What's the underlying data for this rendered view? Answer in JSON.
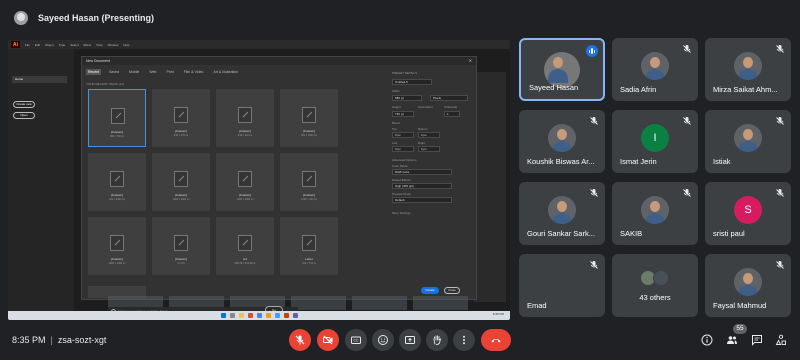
{
  "presenter_bar": {
    "name": "Sayeed Hasan (Presenting)"
  },
  "shared_screen": {
    "app_logo": "Ai",
    "menu": [
      "File",
      "Edit",
      "Object",
      "Type",
      "Select",
      "Effect",
      "View",
      "Window",
      "Help"
    ],
    "home_pane": {
      "home_label": "Home",
      "create_new": "Create new",
      "open": "Open"
    },
    "dialog": {
      "title": "New Document",
      "tabs": [
        "Recent",
        "Saved",
        "Mobile",
        "Web",
        "Print",
        "Film & Video",
        "Art & Illustration"
      ],
      "recent_label": "YOUR RECENT ITEMS (14)",
      "docs": [
        {
          "name": "[Custom]",
          "size": "980 x 720 px"
        },
        {
          "name": "[Custom]",
          "size": "440 x 178 px"
        },
        {
          "name": "[Custom]",
          "size": "440 x 110 px"
        },
        {
          "name": "[Custom]",
          "size": "800 x 1600 px"
        },
        {
          "name": "[Custom]",
          "size": "442 x 1400 px"
        },
        {
          "name": "[Custom]",
          "size": "1024 x 1024 px"
        },
        {
          "name": "[Custom]",
          "size": "1000 x 1000 px"
        },
        {
          "name": "[Custom]",
          "size": "1200 x 400 px"
        },
        {
          "name": "[Custom]",
          "size": "1920 x 1080 px"
        },
        {
          "name": "[Custom]",
          "size": "4 x 3 ft"
        },
        {
          "name": "A4",
          "size": "595.28 x 841.89 pt"
        },
        {
          "name": "Letter",
          "size": "612 x 792 pt"
        }
      ],
      "template_search_placeholder": "Find more templates on Adobe Stock",
      "go_label": "Go",
      "preset": {
        "header": "PRESET DETAILS",
        "doc_name": "Untitled-5",
        "width_label": "Width",
        "width_value": "980 px",
        "units": "Pixels",
        "height_label": "Height",
        "height_value": "720 px",
        "orientation_label": "Orientation",
        "artboards_label": "Artboards",
        "artboards_value": "1",
        "bleed_label": "Bleed",
        "top_label": "Top",
        "bottom_label": "Bottom",
        "left_label": "Left",
        "right_label": "Right",
        "bleed_value": "0 px",
        "advanced_label": "Advanced Options",
        "color_mode_label": "Color Mode",
        "color_mode_value": "RGB Color",
        "raster_label": "Raster Effects",
        "raster_value": "High (300 ppi)",
        "preview_label": "Preview Mode",
        "preview_value": "Default",
        "more_settings": "More Settings"
      },
      "create_label": "Create",
      "close_label": "Close"
    },
    "taskbar_time": "8:35 PM"
  },
  "participants": [
    {
      "name": "Sayeed Hasan",
      "avatar": "photo",
      "state": "speaking"
    },
    {
      "name": "Sadia Afrin",
      "avatar": "photo",
      "state": "muted"
    },
    {
      "name": "Mirza Saikat Ahm...",
      "avatar": "photo",
      "state": "muted"
    },
    {
      "name": "Koushik Biswas Ar...",
      "avatar": "photo",
      "state": "muted"
    },
    {
      "name": "Ismat Jerin",
      "avatar": "I",
      "state": "muted"
    },
    {
      "name": "Istiak",
      "avatar": "photo",
      "state": "muted"
    },
    {
      "name": "Gouri Sankar Sark...",
      "avatar": "photo",
      "state": "muted"
    },
    {
      "name": "SAKIB",
      "avatar": "photo",
      "state": "muted"
    },
    {
      "name": "sristi paul",
      "avatar": "S",
      "state": "muted"
    },
    {
      "name": "Emad",
      "avatar": "none",
      "state": "muted"
    },
    {
      "name": "43 others",
      "avatar": "group",
      "state": "none"
    },
    {
      "name": "Faysal Mahmud",
      "avatar": "photo",
      "state": "muted"
    }
  ],
  "colors": {
    "background": "#202124",
    "tile": "#3c4043",
    "active_border": "#8ab4f8",
    "danger": "#ea4335",
    "accent": "#1a73e8",
    "ismat_initial": "#0b8043",
    "sristi_initial": "#d81b60"
  },
  "bottom_bar": {
    "time": "8:35 PM",
    "separator": "|",
    "meeting_code": "zsa-sozt-xgt",
    "controls": [
      {
        "name": "mic-off-icon",
        "state": "off"
      },
      {
        "name": "camera-off-icon",
        "state": "off"
      },
      {
        "name": "captions-icon",
        "state": "normal"
      },
      {
        "name": "emoji-icon",
        "state": "normal"
      },
      {
        "name": "present-icon",
        "state": "normal"
      },
      {
        "name": "raise-hand-icon",
        "state": "normal"
      },
      {
        "name": "more-options-icon",
        "state": "normal"
      },
      {
        "name": "hang-up-icon",
        "state": "danger"
      }
    ],
    "right_icons": [
      "info-icon",
      "people-icon",
      "chat-icon",
      "activities-icon"
    ],
    "people_count": "55"
  }
}
